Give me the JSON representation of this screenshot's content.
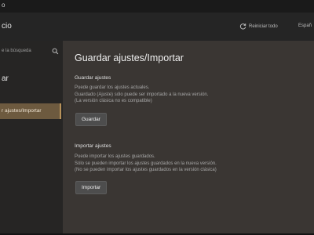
{
  "window": {
    "title": "o"
  },
  "header": {
    "app_name": "cio",
    "reset_label": "Reiniciar todo",
    "language": "Españ"
  },
  "sidebar": {
    "search_placeholder": "e la búsqueda",
    "section_title": "ar",
    "items": [
      {
        "label": "r ajustes/Importar",
        "selected": true
      }
    ]
  },
  "main": {
    "title": "Guardar ajustes/Importar",
    "save_section": {
      "title": "Guardar ajustes",
      "lines": [
        "Puede guardar los ajustes actuales.",
        "Guardado (Ajuste) sólo puede ser importado a la nueva versión.",
        "(La versión clásica no es compatible)"
      ],
      "button": "Guardar"
    },
    "import_section": {
      "title": "Importar ajustes",
      "lines": [
        "Puede importar los ajustes guardados.",
        "Sólo se pueden importar los ajustes guardados en la nueva versión.",
        "(No se pueden importar los ajustes guardados en la versión clásica)"
      ],
      "button": "Importar"
    }
  },
  "colors": {
    "main_bg": "#3a3633",
    "sidebar_bg": "#262524",
    "selected_item_bg": "#6d5a3f",
    "selected_accent": "#b8925a"
  },
  "icons": {
    "reset": "refresh-icon",
    "search": "search-icon"
  }
}
